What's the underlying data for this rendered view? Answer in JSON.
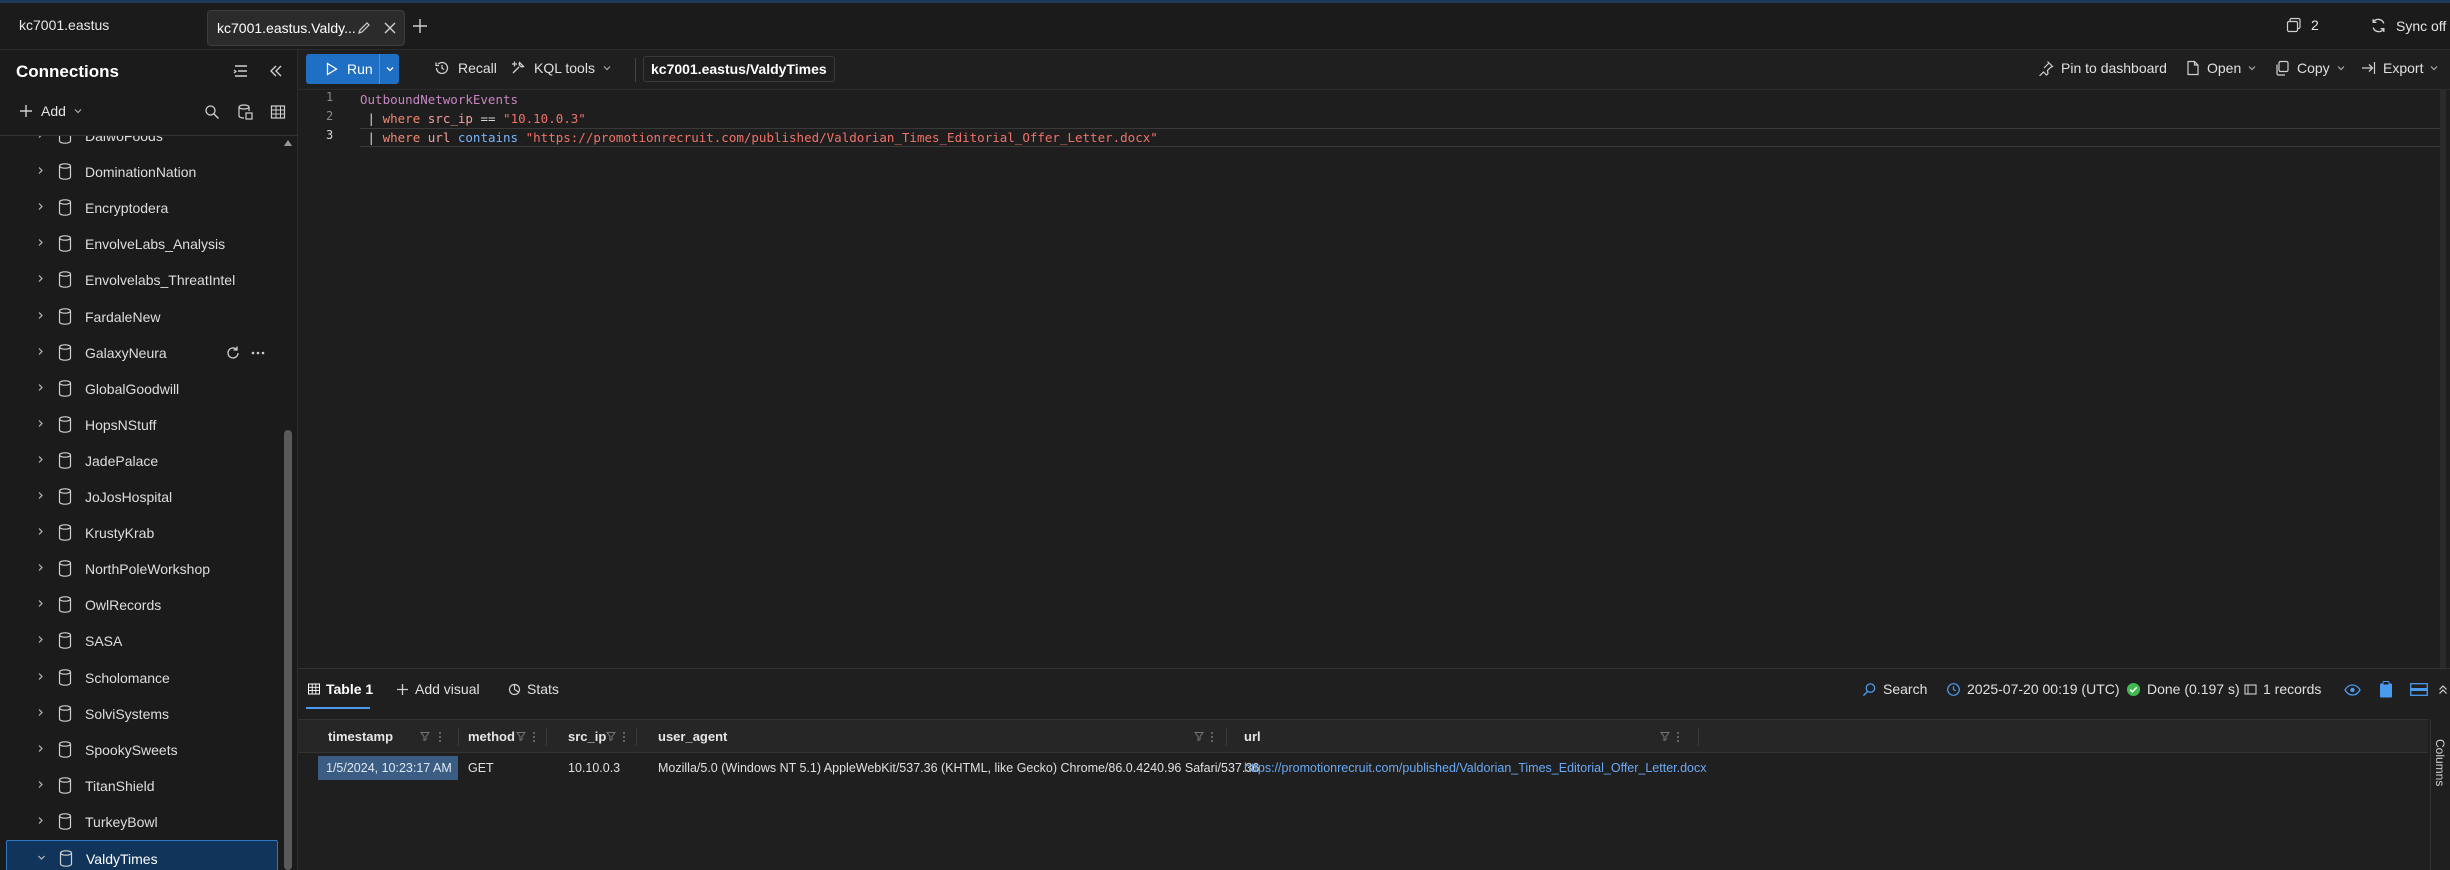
{
  "app": {
    "connection_title": "kc7001.eastus",
    "tab_label": "kc7001.eastus.Valdy...",
    "pages_count": "2",
    "sync_label": "Sync off"
  },
  "sidebar": {
    "title": "Connections",
    "add_label": "Add",
    "databases": [
      {
        "label": "DaiwoFoods"
      },
      {
        "label": "DominationNation"
      },
      {
        "label": "Encryptodera"
      },
      {
        "label": "EnvolveLabs_Analysis"
      },
      {
        "label": "Envolvelabs_ThreatIntel"
      },
      {
        "label": "FardaleNew"
      },
      {
        "label": "GalaxyNeura"
      },
      {
        "label": "GlobalGoodwill"
      },
      {
        "label": "HopsNStuff"
      },
      {
        "label": "JadePalace"
      },
      {
        "label": "JoJosHospital"
      },
      {
        "label": "KrustyKrab"
      },
      {
        "label": "NorthPoleWorkshop"
      },
      {
        "label": "OwlRecords"
      },
      {
        "label": "SASA"
      },
      {
        "label": "Scholomance"
      },
      {
        "label": "SolviSystems"
      },
      {
        "label": "SpookySweets"
      },
      {
        "label": "TitanShield"
      },
      {
        "label": "TurkeyBowl"
      },
      {
        "label": "ValdyTimes"
      }
    ],
    "selected_database": "ValdyTimes"
  },
  "toolbar": {
    "run_label": "Run",
    "recall_label": "Recall",
    "kql_tools_label": "KQL tools",
    "scope_label": "kc7001.eastus/ValdyTimes",
    "pin_label": "Pin to dashboard",
    "open_label": "Open",
    "copy_label": "Copy",
    "export_label": "Export"
  },
  "editor": {
    "line_numbers": [
      "1",
      "2",
      "3"
    ],
    "line1": {
      "table": "OutboundNetworkEvents"
    },
    "line2": {
      "pipe": "|",
      "op": "where",
      "col": "src_ip",
      "cmp": "==",
      "str": "\"10.10.0.3\""
    },
    "line3": {
      "pipe": "|",
      "op": "where",
      "col": "url",
      "fn": "contains",
      "str": "\"https://promotionrecruit.com/published/Valdorian_Times_Editorial_Offer_Letter.docx\""
    }
  },
  "results": {
    "tabs": {
      "table": "Table 1",
      "add_visual": "Add visual",
      "stats": "Stats"
    },
    "search_label": "Search",
    "time_label": "2025-07-20 00:19 (UTC)",
    "status_label": "Done (0.197 s)",
    "records_label": "1 records",
    "columns_rail_label": "Columns",
    "columns": [
      "timestamp",
      "method",
      "src_ip",
      "user_agent",
      "url"
    ],
    "rows": [
      {
        "timestamp": "1/5/2024, 10:23:17 AM",
        "method": "GET",
        "src_ip": "10.10.0.3",
        "user_agent": "Mozilla/5.0 (Windows NT 5.1) AppleWebKit/537.36 (KHTML, like Gecko) Chrome/86.0.4240.96 Safari/537.36",
        "url": "https://promotionrecruit.com/published/Valdorian_Times_Editorial_Offer_Letter.docx"
      }
    ]
  },
  "colors": {
    "accent": "#1f6fc5",
    "selected_bg": "#10345a",
    "success": "#3fb950",
    "link": "#6aaaf5"
  },
  "icons": [
    "tabs-icon",
    "sync-icon",
    "collapse-panel-icon",
    "filter-list-icon",
    "search-icon",
    "database-icon",
    "chevron-right-icon",
    "play-icon",
    "history-icon",
    "tools-icon",
    "pin-icon",
    "file-icon",
    "copy-icon",
    "export-icon",
    "table-icon",
    "clock-icon",
    "check-circle-icon",
    "eye-icon",
    "clipboard-icon",
    "layout-icon"
  ]
}
